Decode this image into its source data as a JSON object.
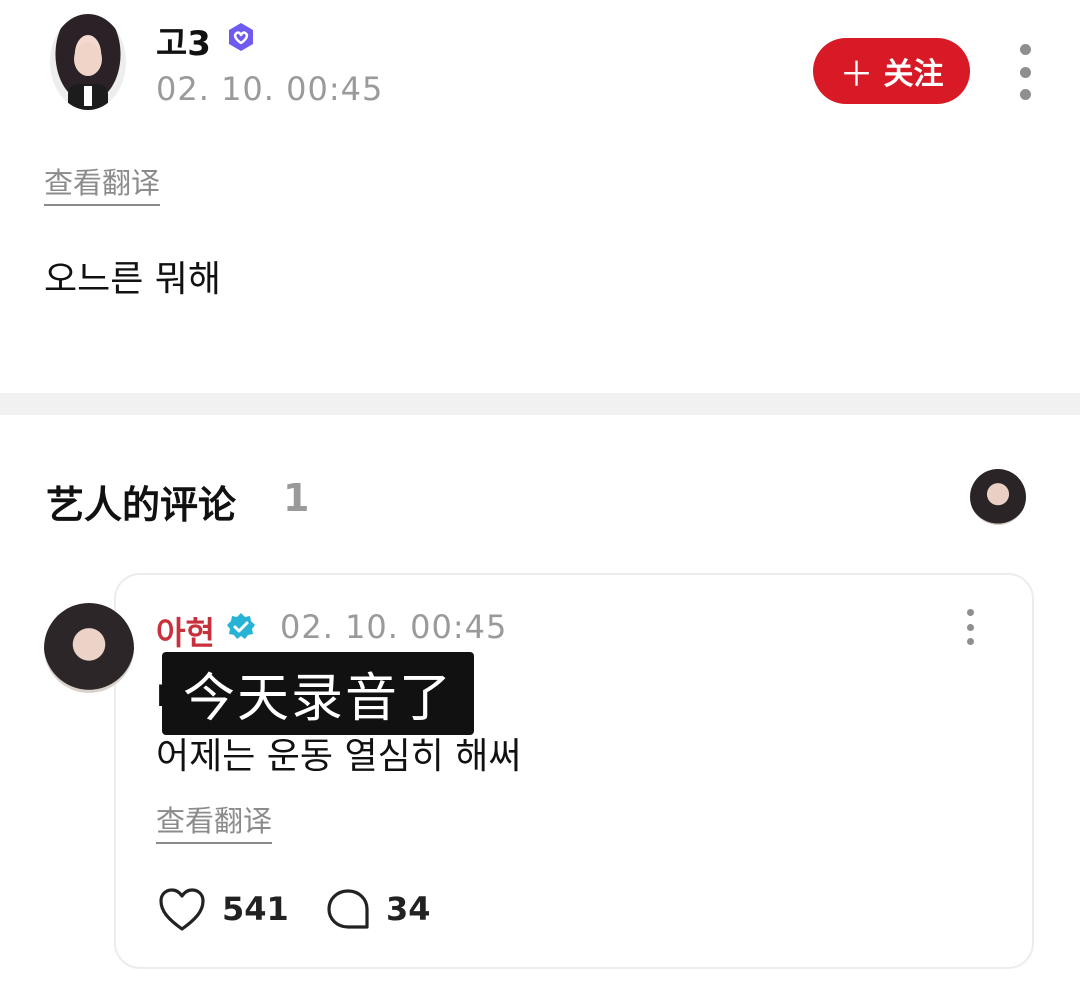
{
  "post": {
    "username": "고3",
    "timestamp": "02. 10. 00:45",
    "follow_label": "关注",
    "see_translation": "查看翻译",
    "body": "오느른 뭐해",
    "verified_icon": "purple-verified-badge"
  },
  "artist_comments": {
    "title": "艺人的评论",
    "count": "1"
  },
  "comment": {
    "name": "아현",
    "timestamp": "02. 10. 00:45",
    "line1": "나",
    "line2": "어제는 운동 열심히 해써",
    "overlay_caption": "今天录音了",
    "see_translation": "查看翻译",
    "likes": "541",
    "replies": "34",
    "verified_icon": "teal-verified-badge"
  },
  "colors": {
    "follow_bg": "#d71a25",
    "artist_name": "#c8313b",
    "muted_text": "#9a9a9a",
    "divider": "#f1f1f1"
  }
}
